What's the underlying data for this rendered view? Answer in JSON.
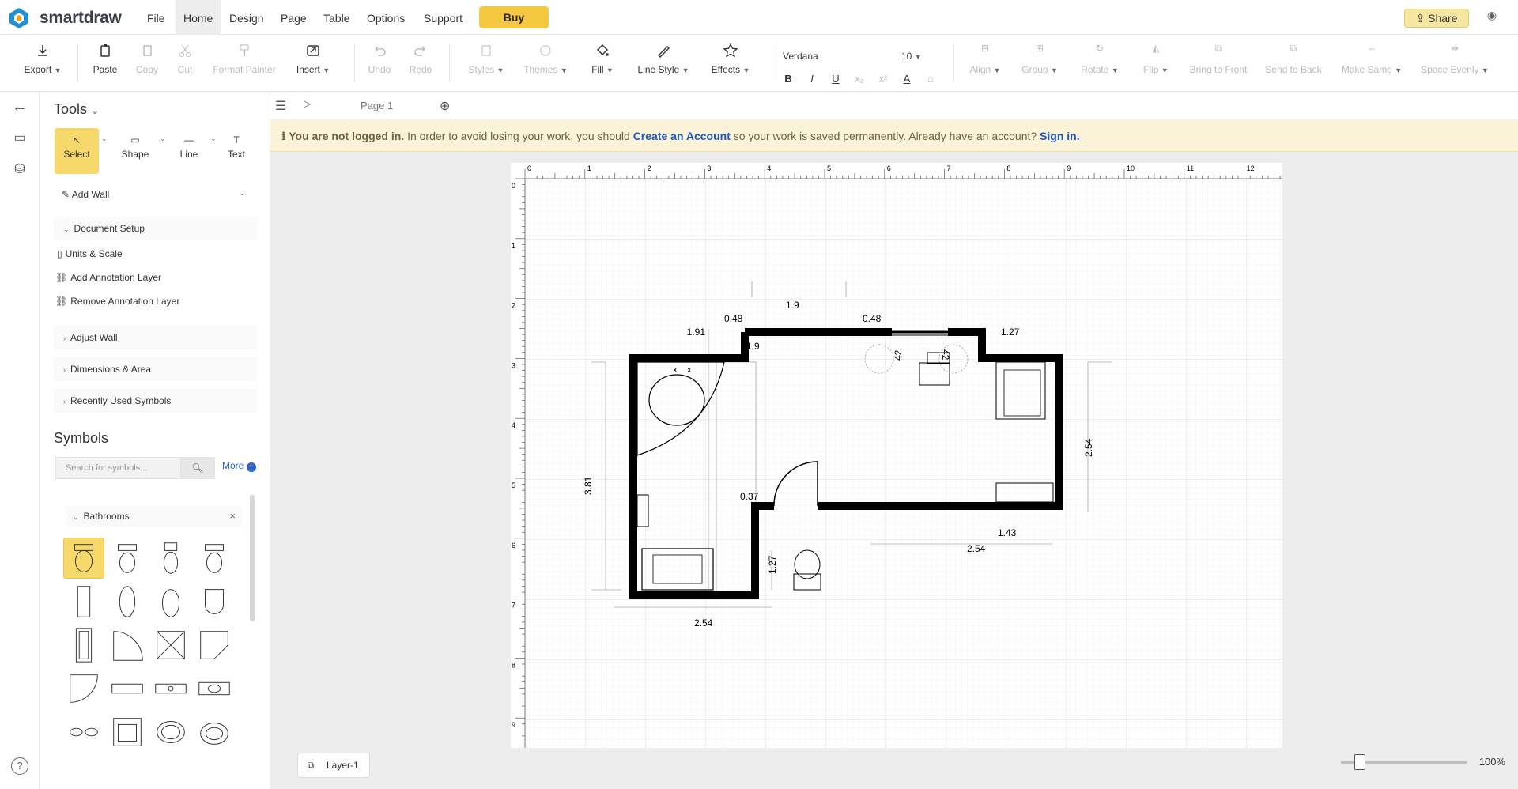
{
  "app": {
    "brand": "smartdraw"
  },
  "menu": {
    "file": "File",
    "home": "Home",
    "design": "Design",
    "page": "Page",
    "table": "Table",
    "options": "Options",
    "support": "Support"
  },
  "buy_label": "Buy",
  "share_label": "Share",
  "toolbar": {
    "export": "Export",
    "paste": "Paste",
    "copy": "Copy",
    "cut": "Cut",
    "format_painter": "Format Painter",
    "insert": "Insert",
    "undo": "Undo",
    "redo": "Redo",
    "styles": "Styles",
    "themes": "Themes",
    "fill": "Fill",
    "line_style": "Line Style",
    "effects": "Effects",
    "font": "Verdana",
    "font_size": "10",
    "align": "Align",
    "group": "Group",
    "rotate": "Rotate",
    "flip": "Flip",
    "bring_to_front": "Bring to Front",
    "send_to_back": "Send to Back",
    "make_same": "Make Same",
    "space_evenly": "Space Evenly"
  },
  "panel": {
    "title": "Tools",
    "tools": {
      "select": "Select",
      "shape": "Shape",
      "line": "Line",
      "text": "Text"
    },
    "add_wall": "Add Wall",
    "document_setup": "Document Setup",
    "units_scale": "Units & Scale",
    "add_annotation": "Add Annotation Layer",
    "remove_annotation": "Remove Annotation Layer",
    "adjust_wall": "Adjust Wall",
    "dimensions_area": "Dimensions & Area",
    "recently_used": "Recently Used Symbols"
  },
  "symbols": {
    "title": "Symbols",
    "search_placeholder": "Search for symbols...",
    "more": "More",
    "library": "Bathrooms"
  },
  "page_tab": "Page 1",
  "notice": {
    "bold": "You are not logged in.",
    "text1": " In order to avoid losing your work, you should ",
    "link1": "Create an Account",
    "text2": " so your work is saved permanently. Already have an account? ",
    "link2": "Sign in."
  },
  "ruler": {
    "h": [
      "0",
      "1",
      "2",
      "3",
      "4",
      "5",
      "6",
      "7",
      "8",
      "9",
      "10",
      "11",
      "12"
    ],
    "v": [
      "0",
      "1",
      "2",
      "3",
      "4",
      "5",
      "6",
      "7",
      "8",
      "9"
    ]
  },
  "dimensions": {
    "top": "1.9",
    "top_left": "0.48",
    "top_right": "0.48",
    "left_top": "1.91",
    "right_top": "1.27",
    "right_side": "2.54",
    "left_side": "3.81",
    "door": "0.37",
    "window_left": "42",
    "window_right": "42",
    "inner_right": "1.43",
    "inner_bottom": "2.54",
    "inner_left": "1.27",
    "bottom": "2.54"
  },
  "layer": "Layer-1",
  "zoom": {
    "label": "100%",
    "level": 0.15
  }
}
